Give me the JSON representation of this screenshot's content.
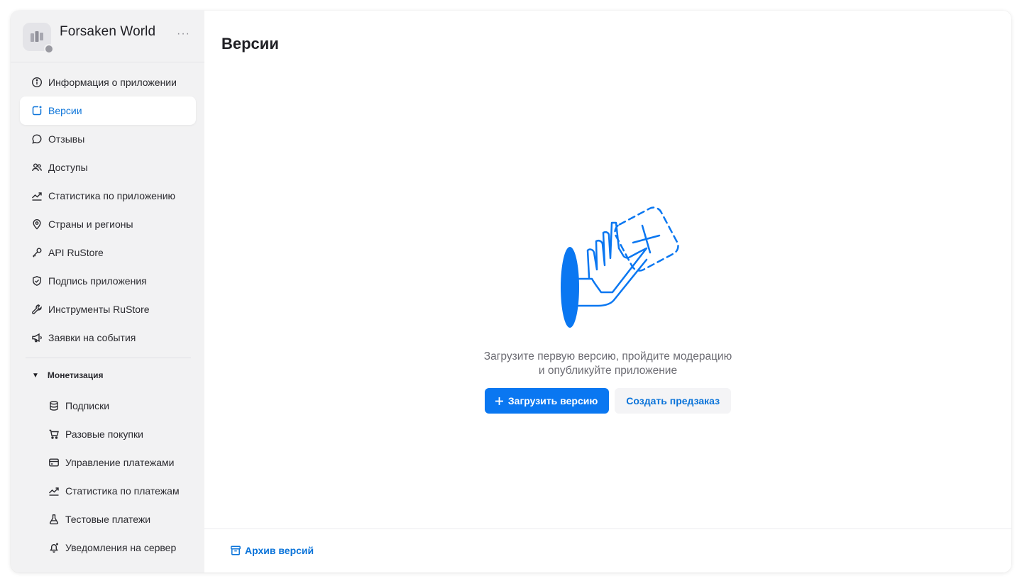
{
  "app": {
    "name": "Forsaken World",
    "more": "···"
  },
  "sidebar": {
    "items": [
      {
        "label": "Информация о приложении",
        "icon": "info-icon"
      },
      {
        "label": "Версии",
        "icon": "versions-icon",
        "active": true
      },
      {
        "label": "Отзывы",
        "icon": "chat-bubble-icon"
      },
      {
        "label": "Доступы",
        "icon": "users-icon"
      },
      {
        "label": "Статистика по приложению",
        "icon": "trend-chart-icon"
      },
      {
        "label": "Страны и регионы",
        "icon": "location-pin-icon"
      },
      {
        "label": "API RuStore",
        "icon": "key-icon"
      },
      {
        "label": "Подпись приложения",
        "icon": "shield-check-icon"
      },
      {
        "label": "Инструменты RuStore",
        "icon": "wrench-icon"
      },
      {
        "label": "Заявки на события",
        "icon": "megaphone-icon"
      }
    ],
    "monetization": {
      "label": "Монетизация",
      "expanded": true,
      "items": [
        {
          "label": "Подписки",
          "icon": "database-icon"
        },
        {
          "label": "Разовые покупки",
          "icon": "cart-icon"
        },
        {
          "label": "Управление платежами",
          "icon": "credit-card-icon"
        },
        {
          "label": "Статистика по платежам",
          "icon": "trend-chart-icon"
        },
        {
          "label": "Тестовые платежи",
          "icon": "flask-icon"
        },
        {
          "label": "Уведомления на сервер",
          "icon": "bell-icon"
        }
      ]
    }
  },
  "main": {
    "title": "Версии",
    "empty_state": {
      "line1": "Загрузите первую версию, пройдите модерацию",
      "line2": "и опубликуйте приложение"
    },
    "upload_button": "Загрузить версию",
    "preorder_button": "Создать предзаказ",
    "archive_link": "Архив версий"
  },
  "colors": {
    "accent": "#0a77f1",
    "link": "#0a73d9",
    "sidebar_bg": "#f2f2f3"
  }
}
